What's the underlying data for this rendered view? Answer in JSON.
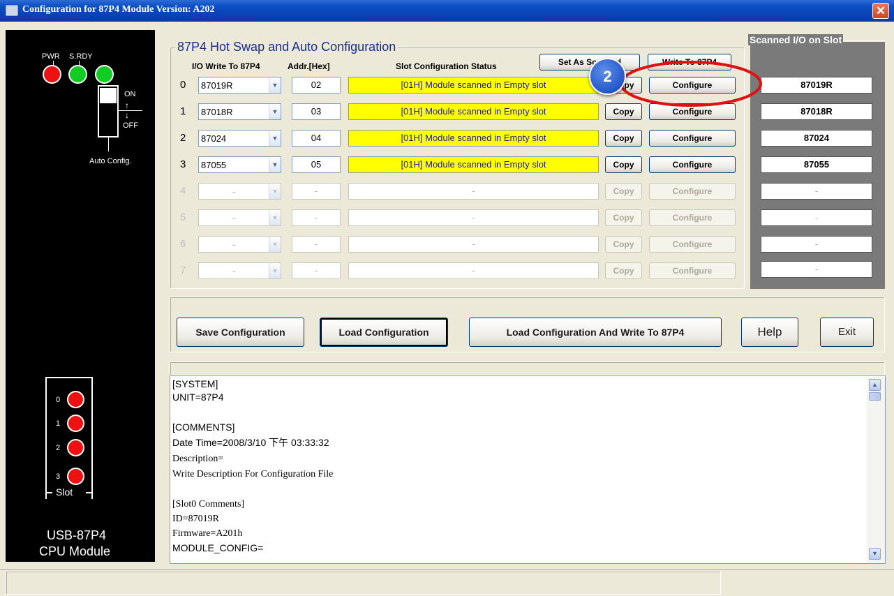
{
  "window": {
    "title": "Configuration for 87P4 Module Version: A202",
    "close_glyph": "✕"
  },
  "cpu": {
    "pwr_label": "PWR",
    "srdy_label": "S.RDY",
    "switch_on": "ON",
    "switch_off": "OFF",
    "auto_config_label": "Auto Config.",
    "slot_leds": [
      "0",
      "1",
      "2",
      "3"
    ],
    "slot_label": "Slot",
    "model": "USB-87P4",
    "model_sub": "CPU Module"
  },
  "hotswap": {
    "title": "87P4 Hot Swap and Auto Configuration",
    "col_io": "I/O Write To 87P4",
    "col_addr": "Addr.[Hex]",
    "col_status": "Slot Configuration Status",
    "set_as_scanned": "Set As Scanned",
    "write_to_87p4": "Write To 87P4",
    "copy_label": "Copy",
    "configure_label": "Configure",
    "rows": [
      {
        "slot": "0",
        "module": "87019R",
        "addr": "02",
        "status": "[01H] Module scanned in Empty slot",
        "active": true
      },
      {
        "slot": "1",
        "module": "87018R",
        "addr": "03",
        "status": "[01H] Module scanned in Empty slot",
        "active": true
      },
      {
        "slot": "2",
        "module": "87024",
        "addr": "04",
        "status": "[01H] Module scanned in Empty slot",
        "active": true
      },
      {
        "slot": "3",
        "module": "87055",
        "addr": "05",
        "status": "[01H] Module scanned in Empty slot",
        "active": true
      },
      {
        "slot": "4",
        "module": "-",
        "addr": "-",
        "status": "-",
        "active": false
      },
      {
        "slot": "5",
        "module": "-",
        "addr": "-",
        "status": "-",
        "active": false
      },
      {
        "slot": "6",
        "module": "-",
        "addr": "-",
        "status": "-",
        "active": false
      },
      {
        "slot": "7",
        "module": "-",
        "addr": "-",
        "status": "-",
        "active": false
      }
    ]
  },
  "scanned": {
    "title": "Scanned I/O on Slot",
    "values": [
      "87019R",
      "87018R",
      "87024",
      "87055",
      "-",
      "-",
      "-",
      "-"
    ]
  },
  "buttons": {
    "save": "Save Configuration",
    "load": "Load Configuration",
    "load_write": "Load  Configuration And Write To 87P4",
    "help": "Help",
    "exit": "Exit"
  },
  "log": {
    "lines": [
      {
        "text": "[SYSTEM]",
        "serif": false
      },
      {
        "text": "UNIT=87P4",
        "serif": false
      },
      {
        "text": "",
        "serif": false
      },
      {
        "text": "[COMMENTS]",
        "serif": false
      },
      {
        "text": "Date Time=2008/3/10 下午 03:33:32",
        "serif": false
      },
      {
        "text": "Description=",
        "serif": true
      },
      {
        "text": "Write Description For Configuration  File",
        "serif": true
      },
      {
        "text": "",
        "serif": true
      },
      {
        "text": "[Slot0 Comments]",
        "serif": true
      },
      {
        "text": "ID=87019R",
        "serif": true
      },
      {
        "text": "Firmware=A201h",
        "serif": true
      },
      {
        "text": "MODULE_CONFIG=",
        "serif": false
      }
    ]
  },
  "annotation": {
    "marker": "2",
    "ring_color": "#e01010"
  }
}
